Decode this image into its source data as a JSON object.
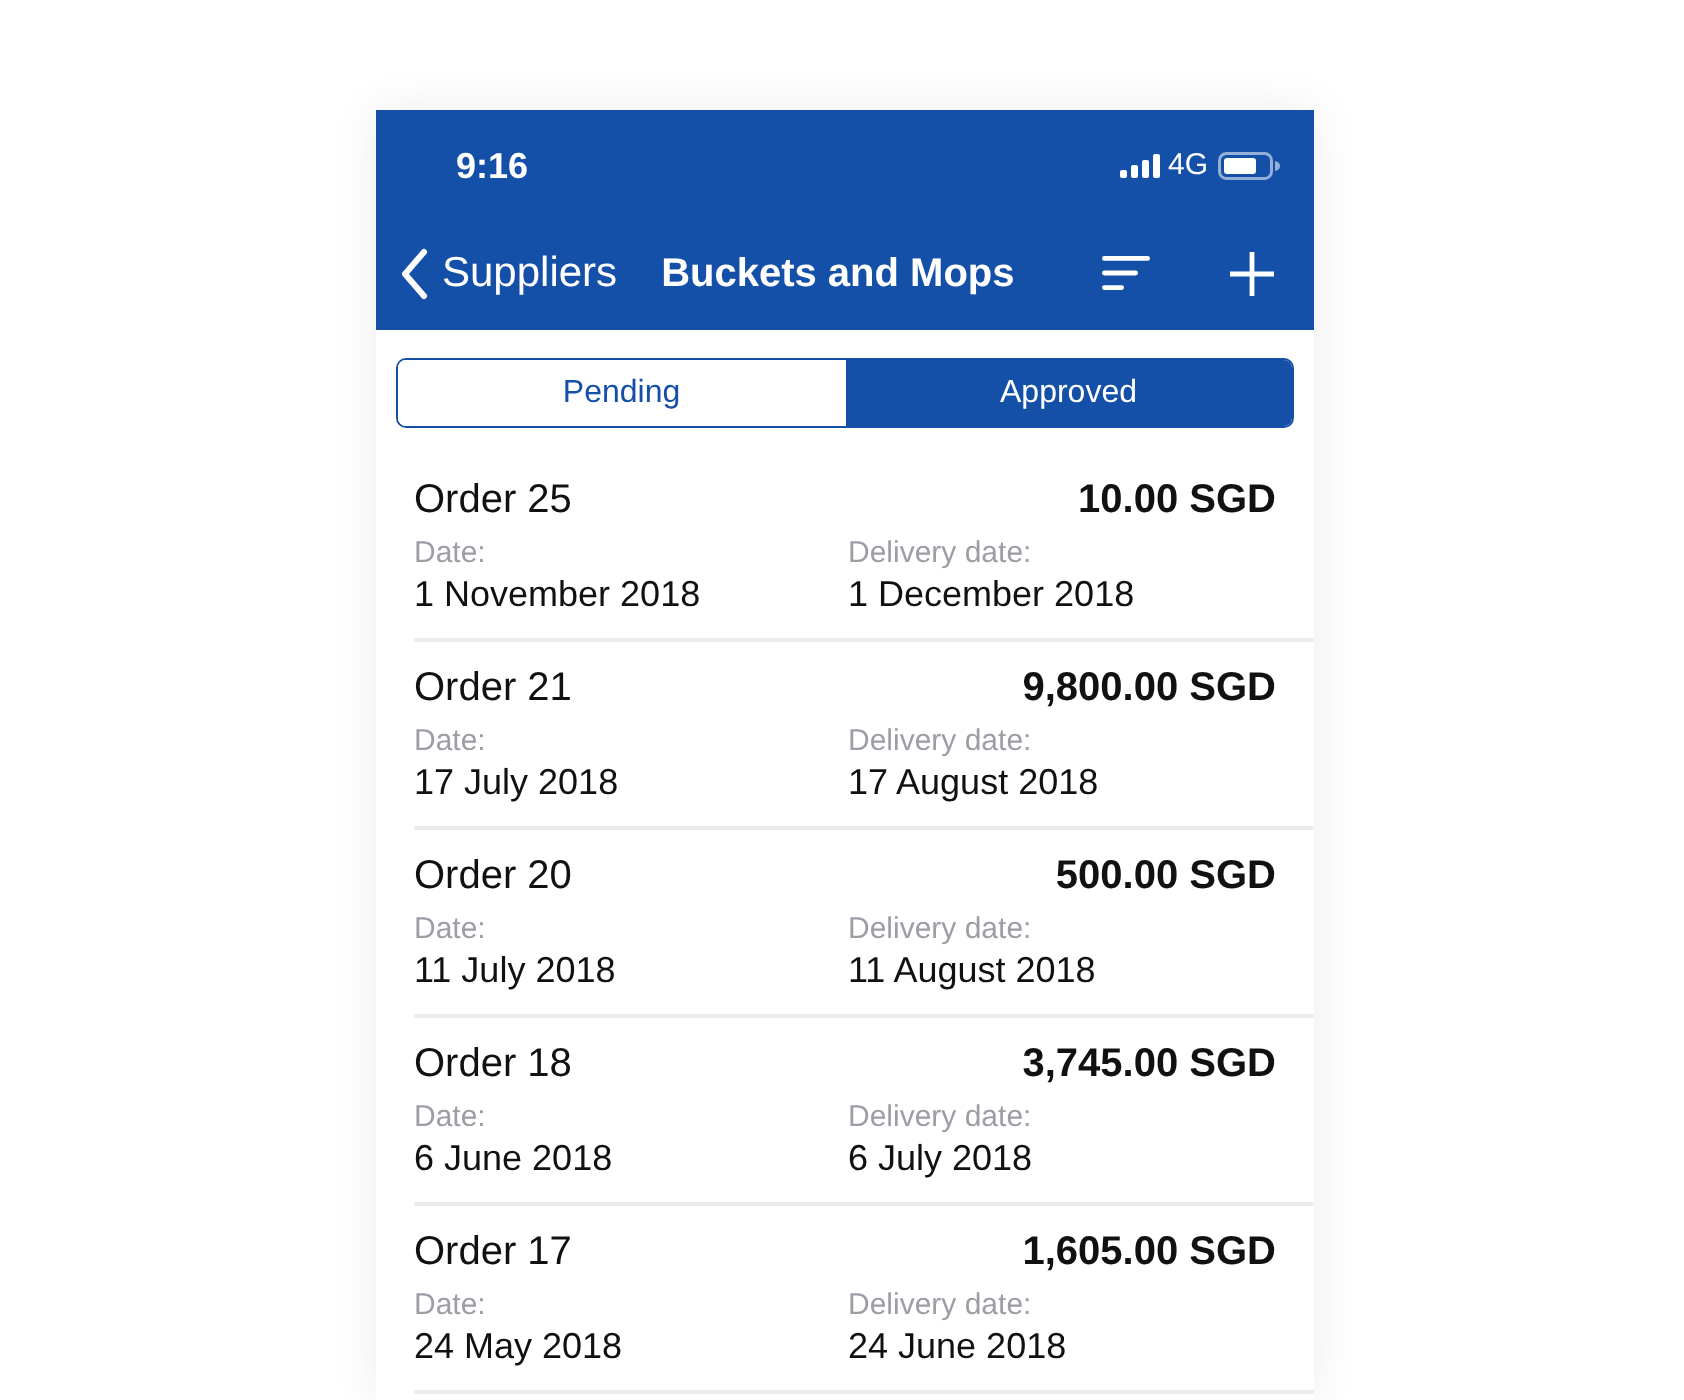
{
  "status_bar": {
    "time": "9:16",
    "network": "4G"
  },
  "nav_bar": {
    "back_label": "Suppliers",
    "title": "Buckets and Mops"
  },
  "tabs": [
    {
      "label": "Pending",
      "selected": false
    },
    {
      "label": "Approved",
      "selected": true
    }
  ],
  "orders": [
    {
      "title": "Order 25",
      "amount": "10.00 SGD",
      "date_label": "Date:",
      "date": "1 November 2018",
      "delivery_label": "Delivery date:",
      "delivery_date": "1 December 2018"
    },
    {
      "title": "Order 21",
      "amount": "9,800.00 SGD",
      "date_label": "Date:",
      "date": "17 July 2018",
      "delivery_label": "Delivery date:",
      "delivery_date": "17 August 2018"
    },
    {
      "title": "Order 20",
      "amount": "500.00 SGD",
      "date_label": "Date:",
      "date": "11 July 2018",
      "delivery_label": "Delivery date:",
      "delivery_date": "11 August 2018"
    },
    {
      "title": "Order 18",
      "amount": "3,745.00 SGD",
      "date_label": "Date:",
      "date": "6 June 2018",
      "delivery_label": "Delivery date:",
      "delivery_date": "6 July 2018"
    },
    {
      "title": "Order 17",
      "amount": "1,605.00 SGD",
      "date_label": "Date:",
      "date": "24 May 2018",
      "delivery_label": "Delivery date:",
      "delivery_date": "24 June 2018"
    }
  ]
}
